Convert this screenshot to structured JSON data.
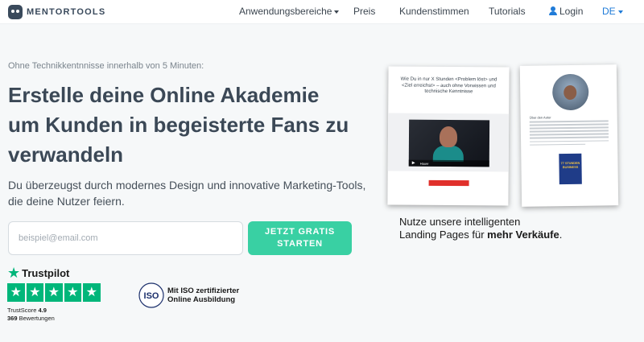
{
  "nav": {
    "logo_text": "MENTORTOOLS",
    "items": [
      {
        "label": "Anwendungsbereiche",
        "dropdown": true
      },
      {
        "label": "Preis"
      },
      {
        "label": "Kundenstimmen"
      },
      {
        "label": "Tutorials"
      },
      {
        "label": "Login",
        "icon": "user-icon"
      },
      {
        "label": "DE",
        "dropdown": true
      }
    ]
  },
  "hero": {
    "eyebrow": "Ohne Technikkentnnisse innerhalb von 5 Minuten:",
    "headline": "Erstelle deine Online Akademie um Kunden in begeisterte Fans zu verwandeln",
    "subline": "Du überzeugst durch modernes Design und innovative Marketing-Tools, die deine Nutzer feiern.",
    "email_placeholder": "beispiel@email.com",
    "cta_label": "JETZT GRATIS STARTEN"
  },
  "trust": {
    "trustpilot_name": "Trustpilot",
    "stars": 5,
    "score_label": "TrustScore",
    "score_value": "4.9",
    "reviews_count": "369",
    "reviews_label": "Bewertungen",
    "iso_line1": "Mit ISO zertifizierter",
    "iso_line2": "Online Ausbildung",
    "iso_badge_text": "ISO"
  },
  "mockup": {
    "page1_headline": "Wie Du in nur X Stunden <Problem löst> und <Ziel erreichst> – auch ohne Vorwissen und technische Kenntnisse",
    "page1_video_caption": "Hauer",
    "page2_section": "Über den Autor",
    "book_title": "77 STUNDEN BUSINESS"
  },
  "caption": {
    "line1": "Nutze unsere intelligenten",
    "line2_prefix": "Landing Pages für ",
    "line2_bold": "mehr Verkäufe",
    "line2_suffix": "."
  },
  "colors": {
    "accent_green": "#39d0a3",
    "link_blue": "#1f7bd8",
    "trustpilot_green": "#00b67a",
    "headline": "#3b4856",
    "background": "#f6f8f9"
  }
}
